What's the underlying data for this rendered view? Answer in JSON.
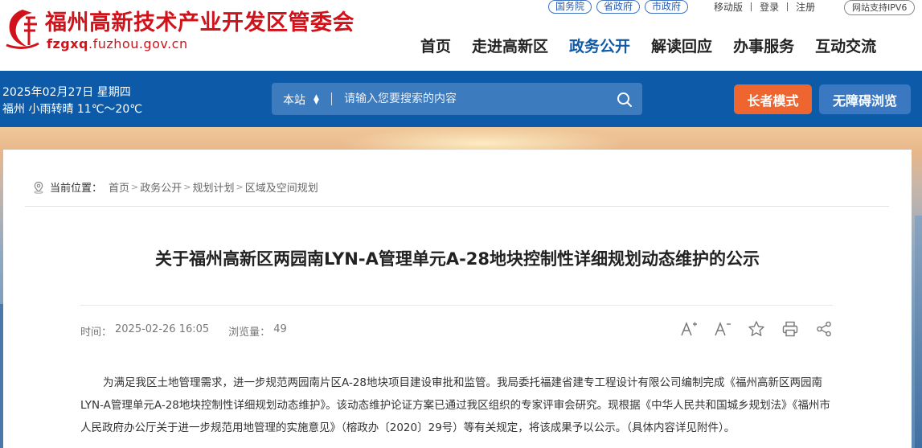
{
  "header": {
    "site_title": "福州高新技术产业开发区管委会",
    "site_domain_bold": "fzgxq",
    "site_domain_rest": ".fuzhou.gov.cn",
    "gov_links": [
      "国务院",
      "省政府",
      "市政府"
    ],
    "util_links": [
      "移动版",
      "登录",
      "注册"
    ],
    "ipv6": "网站支持IPV6",
    "nav": [
      "首页",
      "走进高新区",
      "政务公开",
      "解读回应",
      "办事服务",
      "互动交流"
    ],
    "active_nav": "政务公开"
  },
  "bar": {
    "date": "2025年02月27日 星期四",
    "weather": "福州 小雨转晴 11℃～20℃",
    "search_scope": "本站",
    "search_placeholder": "请输入您要搜索的内容",
    "elder_mode": "长者模式",
    "accessibility": "无障碍浏览"
  },
  "breadcrumb": {
    "label": "当前位置：",
    "items": [
      "首页",
      "政务公开",
      "规划计划",
      "区域及空间规划"
    ]
  },
  "article": {
    "title": "关于福州高新区两园南LYN-A管理单元A-28地块控制性详细规划动态维护的公示",
    "time_label": "时间：",
    "time_value": "2025-02-26 16:05",
    "views_label": "浏览量：",
    "views_value": "49",
    "body": "为满足我区土地管理需求，进一步规范两园南片区A-28地块项目建设审批和监管。我局委托福建省建专工程设计有限公司编制完成《福州高新区两园南LYN-A管理单元A-28地块控制性详细规划动态维护》。该动态维护论证方案已通过我区组织的专家评审会研究。现根据《中华人民共和国城乡规划法》《福州市人民政府办公厅关于进一步规范用地管理的实施意见》（榕政办〔2020〕29号）等有关规定，将该成果予以公示。（具体内容详见附件）。"
  },
  "colors": {
    "brand_red": "#d0121b",
    "nav_blue": "#0d5ba8",
    "elder_orange": "#ee6530"
  }
}
